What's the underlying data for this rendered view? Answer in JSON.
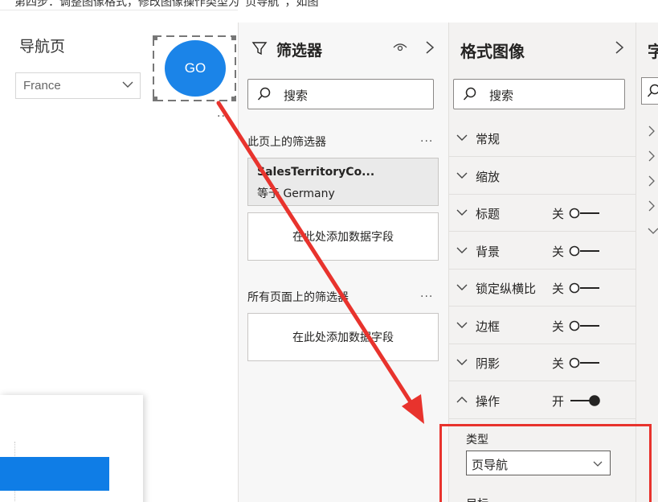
{
  "top_strip": {
    "caption": "第四步：调整图像格式，修改图像操作类型为“页导航”，如图"
  },
  "canvas": {
    "nav_title": "导航页",
    "slicer_value": "France",
    "go_button": "GO",
    "more": "..."
  },
  "filter_pane": {
    "title": "筛选器",
    "search_placeholder": "搜索",
    "page_filters_label": "此页上的筛选器",
    "more": "...",
    "filter_card": {
      "field": "SalesTerritoryCo...",
      "condition": "等于 Germany"
    },
    "add_field_1": "在此处添加数据字段",
    "all_pages_label": "所有页面上的筛选器",
    "add_field_2": "在此处添加数据字段"
  },
  "format_pane": {
    "title": "格式图像",
    "search_placeholder": "搜索",
    "rows": [
      {
        "label": "常规",
        "state": "",
        "expanded": false
      },
      {
        "label": "缩放",
        "state": "",
        "expanded": false
      },
      {
        "label": "标题",
        "state": "关",
        "expanded": false
      },
      {
        "label": "背景",
        "state": "关",
        "expanded": false
      },
      {
        "label": "锁定纵横比",
        "state": "关",
        "expanded": false
      },
      {
        "label": "边框",
        "state": "关",
        "expanded": false
      },
      {
        "label": "阴影",
        "state": "关",
        "expanded": false
      },
      {
        "label": "操作",
        "state": "开",
        "expanded": true
      }
    ],
    "type_label": "类型",
    "type_value": "页导航",
    "destination_label": "目标"
  },
  "right_pane": {
    "title": "字"
  },
  "colors": {
    "accent": "#1b84e8",
    "highlight_red": "#e8332d"
  }
}
